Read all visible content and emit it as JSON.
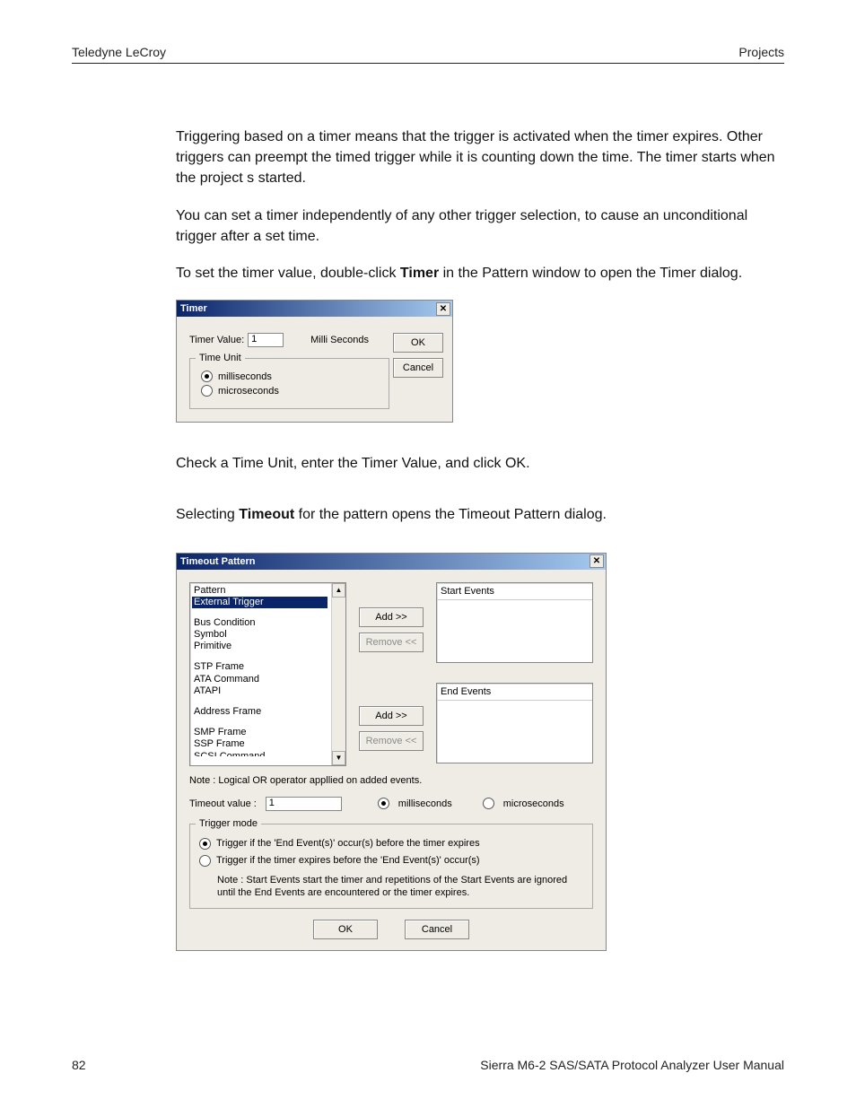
{
  "header": {
    "left": "Teledyne LeCroy",
    "right": "Projects"
  },
  "para1": "Triggering based on a timer means that the trigger is activated when the timer expires. Other triggers can preempt the timed trigger while it is counting down the time. The timer starts when the project s started.",
  "para2": "You can set a timer independently of any other trigger selection, to cause an unconditional trigger after a set time.",
  "para3_pre": "To set the timer value, double-click ",
  "para3_bold": "Timer",
  "para3_post": " in the Pattern window to open the Timer dialog.",
  "timer_dialog": {
    "title": "Timer",
    "close": "✕",
    "timer_value_label": "Timer Value:",
    "timer_value": "1",
    "unit_label": "Milli Seconds",
    "ok": "OK",
    "cancel": "Cancel",
    "time_unit_legend": "Time Unit",
    "radio_ms": "milliseconds",
    "radio_us": "microseconds"
  },
  "para4": "Check a Time Unit, enter the Timer Value, and click OK.",
  "para5_pre": "Selecting ",
  "para5_bold": "Timeout",
  "para5_post": " for the pattern opens the Timeout Pattern dialog.",
  "timeout_dialog": {
    "title": "Timeout Pattern",
    "close": "✕",
    "pattern_label": "Pattern",
    "pattern_items": [
      "External Trigger",
      "",
      "Bus Condition",
      "Symbol",
      "Primitive",
      "",
      "STP Frame",
      "ATA Command",
      "ATAPI",
      "",
      "Address Frame",
      "",
      "SMP Frame",
      "SSP Frame",
      "SCSI Command"
    ],
    "selected_index": 0,
    "add": "Add >>",
    "remove": "Remove <<",
    "start_events": "Start Events",
    "end_events": "End Events",
    "note_or": "Note : Logical OR operator appllied on added events.",
    "timeout_value_label": "Timeout value :",
    "timeout_value": "1",
    "radio_ms": "milliseconds",
    "radio_us": "microseconds",
    "trigger_mode_legend": "Trigger mode",
    "trig_opt1": "Trigger if the 'End Event(s)' occur(s) before the timer expires",
    "trig_opt2": "Trigger if the timer expires before the 'End Event(s)' occur(s)",
    "trig_note": "Note : Start Events start the timer and repetitions of the Start Events are ignored until the End Events are encountered or the timer expires.",
    "ok": "OK",
    "cancel": "Cancel",
    "scroll_up": "▲",
    "scroll_down": "▼"
  },
  "footer": {
    "page": "82",
    "manual": "Sierra M6-2 SAS/SATA Protocol Analyzer User Manual"
  }
}
